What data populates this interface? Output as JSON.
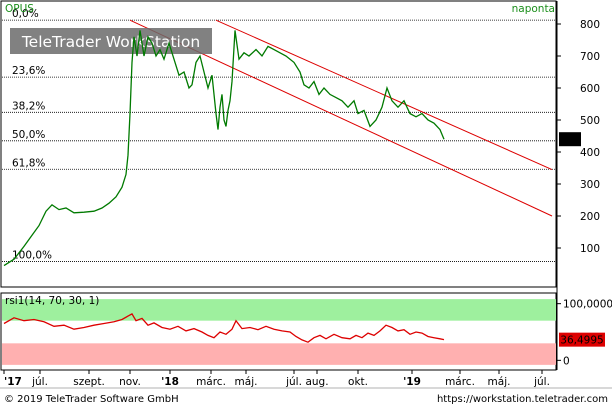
{
  "header": {
    "symbol": "OPUS",
    "period": "naponta",
    "watermark": "TeleTrader WorkStation"
  },
  "footer": {
    "copyright": "© 2019 TeleTrader Software GmbH",
    "url": "https://workstation.teletrader.com"
  },
  "colors": {
    "price": "#007a00",
    "channel": "#dd0000",
    "rsi_line": "#dd0000",
    "overbought_band": "#9ef09e",
    "oversold_band": "#ffb0b0",
    "last_price_box": "#000000",
    "last_rsi_box": "#dd0000",
    "grid": "#000000"
  },
  "chart_data": [
    {
      "type": "line",
      "title": "OPUS",
      "y_axis": {
        "min": 0,
        "max": 850,
        "ticks": [
          100,
          200,
          300,
          400,
          500,
          600,
          700,
          800
        ],
        "position": "right"
      },
      "x_axis": {
        "tick_labels": [
          "'17",
          "júl.",
          "szept.",
          "nov.",
          "'18",
          "márc.",
          "máj.",
          "júl.",
          "aug.",
          "okt.",
          "'19",
          "márc.",
          "máj.",
          "júl."
        ],
        "tick_index": [
          0,
          36,
          85,
          126,
          166,
          207,
          242,
          290,
          313,
          354,
          408,
          456,
          495,
          538
        ]
      },
      "last_value_label": "440",
      "last_value": 440,
      "fibonacci_levels": [
        {
          "label": "0,0%",
          "value": 812
        },
        {
          "label": "23,6%",
          "value": 634
        },
        {
          "label": "38,2%",
          "value": 524
        },
        {
          "label": "50,0%",
          "value": 435
        },
        {
          "label": "61,8%",
          "value": 346
        },
        {
          "label": "100,0%",
          "value": 58
        }
      ],
      "series_points": [
        [
          0,
          45
        ],
        [
          10,
          65
        ],
        [
          20,
          105
        ],
        [
          28,
          140
        ],
        [
          35,
          170
        ],
        [
          42,
          215
        ],
        [
          48,
          235
        ],
        [
          55,
          220
        ],
        [
          62,
          225
        ],
        [
          70,
          210
        ],
        [
          80,
          212
        ],
        [
          90,
          215
        ],
        [
          98,
          225
        ],
        [
          105,
          240
        ],
        [
          112,
          260
        ],
        [
          118,
          290
        ],
        [
          122,
          330
        ],
        [
          124,
          390
        ],
        [
          126,
          520
        ],
        [
          128,
          680
        ],
        [
          130,
          760
        ],
        [
          133,
          700
        ],
        [
          136,
          780
        ],
        [
          140,
          700
        ],
        [
          144,
          760
        ],
        [
          148,
          740
        ],
        [
          152,
          700
        ],
        [
          156,
          720
        ],
        [
          160,
          690
        ],
        [
          165,
          740
        ],
        [
          170,
          690
        ],
        [
          175,
          640
        ],
        [
          180,
          650
        ],
        [
          185,
          600
        ],
        [
          188,
          610
        ],
        [
          192,
          680
        ],
        [
          196,
          700
        ],
        [
          200,
          650
        ],
        [
          204,
          600
        ],
        [
          208,
          640
        ],
        [
          212,
          520
        ],
        [
          214,
          470
        ],
        [
          216,
          540
        ],
        [
          218,
          580
        ],
        [
          220,
          500
        ],
        [
          222,
          480
        ],
        [
          224,
          530
        ],
        [
          226,
          560
        ],
        [
          228,
          620
        ],
        [
          231,
          780
        ],
        [
          235,
          690
        ],
        [
          240,
          710
        ],
        [
          245,
          700
        ],
        [
          252,
          720
        ],
        [
          258,
          700
        ],
        [
          264,
          730
        ],
        [
          270,
          720
        ],
        [
          276,
          710
        ],
        [
          282,
          700
        ],
        [
          290,
          680
        ],
        [
          296,
          650
        ],
        [
          300,
          610
        ],
        [
          305,
          600
        ],
        [
          310,
          620
        ],
        [
          315,
          580
        ],
        [
          320,
          600
        ],
        [
          326,
          580
        ],
        [
          332,
          570
        ],
        [
          338,
          560
        ],
        [
          344,
          540
        ],
        [
          350,
          560
        ],
        [
          354,
          520
        ],
        [
          360,
          530
        ],
        [
          366,
          480
        ],
        [
          372,
          500
        ],
        [
          378,
          540
        ],
        [
          383,
          600
        ],
        [
          388,
          560
        ],
        [
          394,
          540
        ],
        [
          400,
          560
        ],
        [
          406,
          520
        ],
        [
          412,
          510
        ],
        [
          418,
          520
        ],
        [
          424,
          500
        ],
        [
          430,
          490
        ],
        [
          436,
          470
        ],
        [
          440,
          440
        ]
      ],
      "channel_lines": [
        {
          "from": [
            126,
            812
          ],
          "to": [
            548,
            200
          ]
        },
        {
          "from": [
            212,
            812
          ],
          "to": [
            548,
            345
          ]
        }
      ]
    },
    {
      "type": "line",
      "title": "rsi1(14, 70, 30, 1)",
      "y_axis": {
        "min": -10,
        "max": 110,
        "ticks": [
          0,
          100
        ],
        "tick_labels": [
          "0",
          "100,0000"
        ],
        "position": "right"
      },
      "overbought": 70,
      "oversold": 30,
      "last_value_label": "36,4995",
      "last_value": 36.4995,
      "series_points": [
        [
          0,
          65
        ],
        [
          10,
          75
        ],
        [
          20,
          70
        ],
        [
          30,
          72
        ],
        [
          40,
          68
        ],
        [
          50,
          60
        ],
        [
          60,
          62
        ],
        [
          70,
          55
        ],
        [
          80,
          58
        ],
        [
          90,
          62
        ],
        [
          100,
          65
        ],
        [
          110,
          68
        ],
        [
          118,
          72
        ],
        [
          124,
          78
        ],
        [
          128,
          82
        ],
        [
          132,
          70
        ],
        [
          138,
          74
        ],
        [
          144,
          62
        ],
        [
          150,
          66
        ],
        [
          158,
          58
        ],
        [
          166,
          55
        ],
        [
          174,
          60
        ],
        [
          182,
          52
        ],
        [
          190,
          56
        ],
        [
          198,
          50
        ],
        [
          204,
          44
        ],
        [
          210,
          40
        ],
        [
          216,
          50
        ],
        [
          222,
          46
        ],
        [
          228,
          55
        ],
        [
          232,
          70
        ],
        [
          238,
          56
        ],
        [
          246,
          58
        ],
        [
          254,
          54
        ],
        [
          262,
          60
        ],
        [
          270,
          55
        ],
        [
          278,
          52
        ],
        [
          286,
          50
        ],
        [
          292,
          42
        ],
        [
          298,
          36
        ],
        [
          304,
          32
        ],
        [
          310,
          40
        ],
        [
          316,
          44
        ],
        [
          322,
          38
        ],
        [
          330,
          46
        ],
        [
          338,
          40
        ],
        [
          346,
          38
        ],
        [
          352,
          44
        ],
        [
          358,
          40
        ],
        [
          364,
          48
        ],
        [
          370,
          44
        ],
        [
          376,
          52
        ],
        [
          382,
          62
        ],
        [
          388,
          58
        ],
        [
          394,
          52
        ],
        [
          400,
          54
        ],
        [
          406,
          46
        ],
        [
          412,
          50
        ],
        [
          418,
          48
        ],
        [
          424,
          42
        ],
        [
          430,
          40
        ],
        [
          436,
          38
        ],
        [
          440,
          36.5
        ]
      ]
    }
  ]
}
